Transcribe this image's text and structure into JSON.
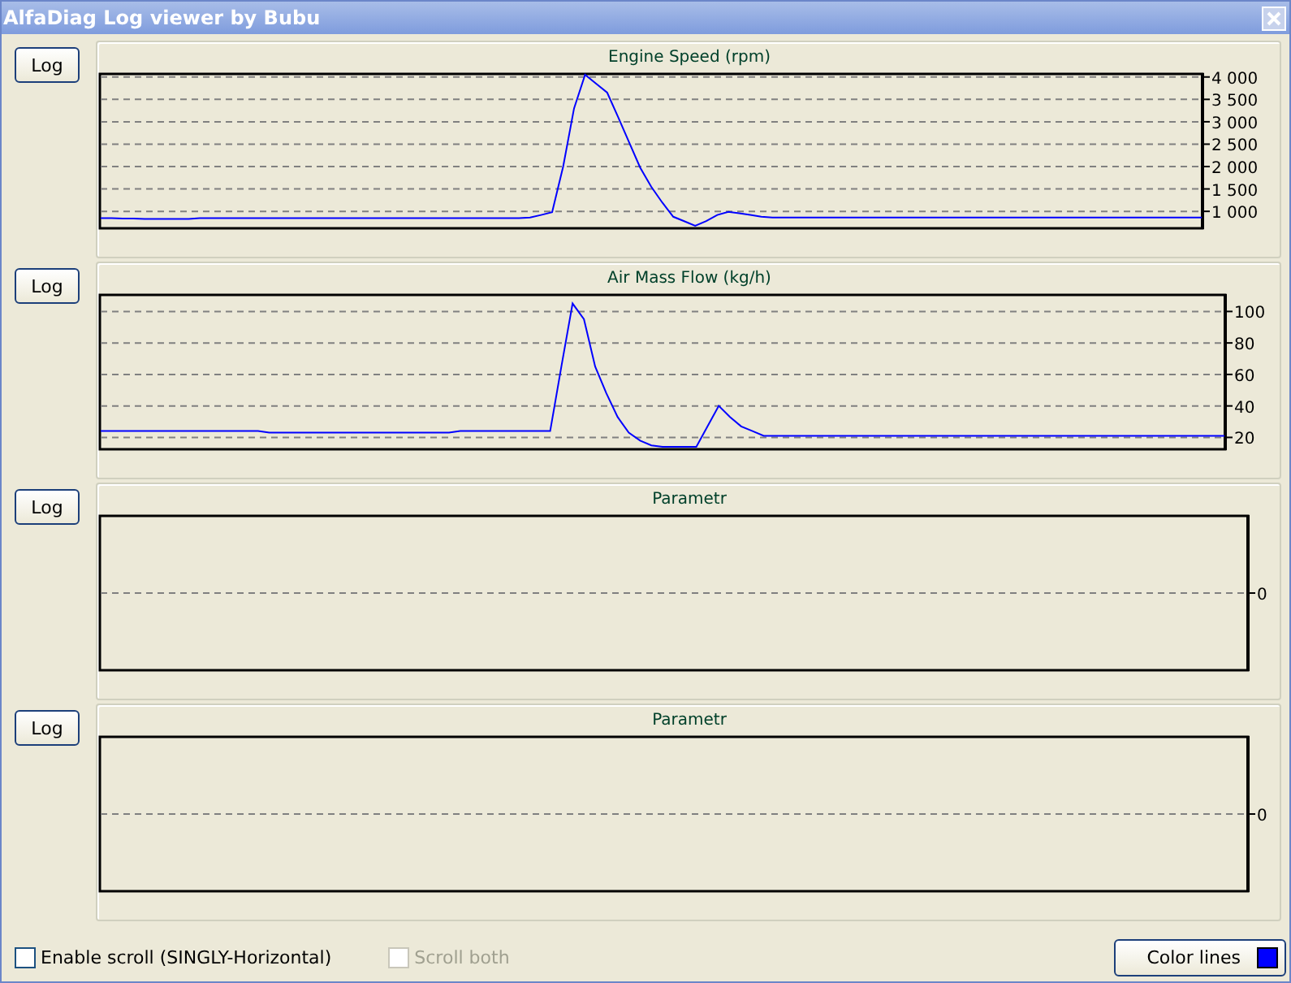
{
  "window": {
    "title": "AlfaDiag Log viewer by Bubu"
  },
  "panels": [
    {
      "button": "Log",
      "chart_data": {
        "type": "line",
        "title": "Engine Speed (rpm)",
        "grid": true,
        "ylim": [
          640,
          4050
        ],
        "yticks": [
          {
            "value": 1000,
            "label": "1 000"
          },
          {
            "value": 1500,
            "label": "1 500"
          },
          {
            "value": 2000,
            "label": "2 000"
          },
          {
            "value": 2500,
            "label": "2 500"
          },
          {
            "value": 3000,
            "label": "3 000"
          },
          {
            "value": 3500,
            "label": "3 500"
          },
          {
            "value": 4000,
            "label": "4 000"
          }
        ],
        "categories": [
          null,
          null,
          null,
          null,
          null,
          null,
          null,
          null,
          null,
          null,
          null,
          null,
          null,
          null,
          null,
          null,
          null,
          null,
          null,
          null,
          null,
          null,
          null,
          null,
          null,
          null,
          null,
          null,
          null,
          null,
          null,
          null,
          null,
          null,
          null,
          null,
          null,
          null,
          null,
          null,
          null,
          null,
          null,
          null,
          null,
          null,
          null,
          null,
          null,
          null,
          null,
          null,
          null,
          null,
          null,
          null,
          null,
          null,
          null,
          null,
          null,
          null,
          null,
          null,
          null,
          null,
          null,
          null,
          null,
          null,
          null,
          null,
          null,
          null,
          null,
          null,
          null,
          null,
          null,
          null,
          null,
          null,
          null,
          null,
          null,
          null,
          null,
          null,
          null,
          null,
          null,
          null,
          null,
          null,
          null,
          null,
          null,
          null,
          null,
          null,
          null
        ],
        "series": [
          {
            "color": "#0000ff",
            "values": [
              850,
              850,
              840,
              840,
              830,
              830,
              830,
              830,
              830,
              850,
              850,
              850,
              850,
              850,
              850,
              850,
              850,
              850,
              850,
              850,
              850,
              850,
              850,
              850,
              850,
              850,
              850,
              850,
              850,
              850,
              850,
              850,
              850,
              850,
              850,
              850,
              850,
              850,
              850,
              860,
              920,
              980,
              2000,
              3300,
              4050,
              3850,
              3650,
              3100,
              2540,
              1980,
              1550,
              1200,
              880,
              780,
              680,
              780,
              920,
              990,
              960,
              920,
              880,
              860,
              860,
              860,
              860,
              860,
              860,
              860,
              860,
              860,
              860,
              860,
              860,
              860,
              860,
              860,
              860,
              860,
              860,
              860,
              860,
              860,
              860,
              860,
              860,
              860,
              860,
              860,
              860,
              860,
              860,
              860,
              860,
              860,
              860,
              860,
              860,
              860,
              860,
              860,
              860
            ]
          }
        ]
      }
    },
    {
      "button": "Log",
      "chart_data": {
        "type": "line",
        "title": "Air Mass Flow (kg/h)",
        "grid": true,
        "ylim": [
          13,
          110
        ],
        "yticks": [
          20,
          40,
          60,
          80,
          100
        ],
        "categories": [
          null,
          null,
          null,
          null,
          null,
          null,
          null,
          null,
          null,
          null,
          null,
          null,
          null,
          null,
          null,
          null,
          null,
          null,
          null,
          null,
          null,
          null,
          null,
          null,
          null,
          null,
          null,
          null,
          null,
          null,
          null,
          null,
          null,
          null,
          null,
          null,
          null,
          null,
          null,
          null,
          null,
          null,
          null,
          null,
          null,
          null,
          null,
          null,
          null,
          null,
          null,
          null,
          null,
          null,
          null,
          null,
          null,
          null,
          null,
          null,
          null,
          null,
          null,
          null,
          null,
          null,
          null,
          null,
          null,
          null,
          null,
          null,
          null,
          null,
          null,
          null,
          null,
          null,
          null,
          null,
          null,
          null,
          null,
          null,
          null,
          null,
          null,
          null,
          null,
          null,
          null,
          null,
          null,
          null,
          null,
          null,
          null,
          null,
          null,
          null,
          null
        ],
        "series": [
          {
            "color": "#0000ff",
            "values": [
              24,
              24,
              24,
              24,
              24,
              24,
              24,
              24,
              24,
              24,
              24,
              24,
              24,
              24,
              24,
              23,
              23,
              23,
              23,
              23,
              23,
              23,
              23,
              23,
              23,
              23,
              23,
              23,
              23,
              23,
              23,
              23,
              24,
              24,
              24,
              24,
              24,
              24,
              24,
              24,
              24,
              65,
              105,
              95,
              65,
              48,
              33,
              23,
              18,
              15,
              14,
              14,
              14,
              14,
              27,
              40,
              33,
              27,
              24,
              21,
              21,
              21,
              21,
              21,
              21,
              21,
              21,
              21,
              21,
              21,
              21,
              21,
              21,
              21,
              21,
              21,
              21,
              21,
              21,
              21,
              21,
              21,
              21,
              21,
              21,
              21,
              21,
              21,
              21,
              21,
              21,
              21,
              21,
              21,
              21,
              21,
              21,
              21,
              21,
              21,
              21
            ]
          }
        ]
      }
    },
    {
      "button": "Log",
      "chart_data": {
        "type": "other",
        "title": "Parametr",
        "annotations": [
          {
            "text": "0"
          }
        ]
      }
    },
    {
      "button": "Log",
      "chart_data": {
        "type": "other",
        "title": "Parametr",
        "annotations": [
          {
            "text": "0"
          }
        ]
      }
    }
  ],
  "options": [
    {
      "label": "Enable scroll (SINGLY-Horizontal)",
      "checked": false,
      "disabled": false
    },
    {
      "label": "Scroll both",
      "checked": false,
      "disabled": true
    }
  ],
  "color_button": {
    "label": "Color lines",
    "color": "#0000ff"
  }
}
